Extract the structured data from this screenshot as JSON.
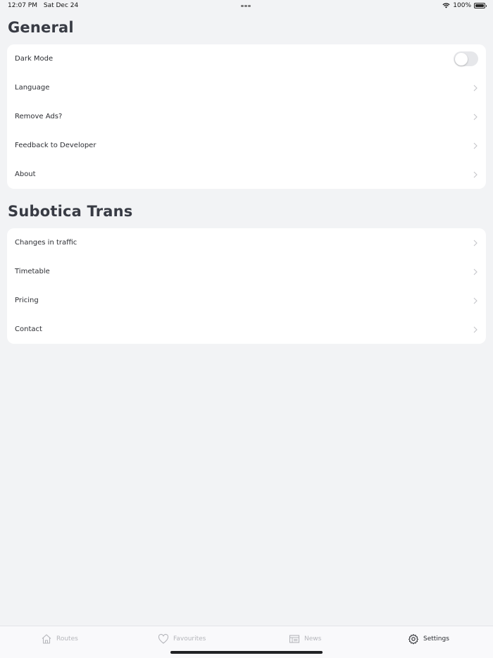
{
  "status_bar": {
    "time": "12:07 PM",
    "date": "Sat Dec 24",
    "battery": "100%",
    "icons": [
      "wifi-icon",
      "battery-icon"
    ]
  },
  "general": {
    "title": "General",
    "dark_mode": {
      "label": "Dark Mode",
      "enabled": false
    },
    "items": [
      {
        "label": "Language"
      },
      {
        "label": "Remove Ads?"
      },
      {
        "label": "Feedback to Developer"
      },
      {
        "label": "About"
      }
    ]
  },
  "subotica": {
    "title": "Subotica Trans",
    "items": [
      {
        "label": "Changes in traffic"
      },
      {
        "label": "Timetable"
      },
      {
        "label": "Pricing"
      },
      {
        "label": "Contact"
      }
    ]
  },
  "tabs": [
    {
      "label": "Routes",
      "icon": "home-icon",
      "active": false
    },
    {
      "label": "Favourites",
      "icon": "heart-icon",
      "active": false
    },
    {
      "label": "News",
      "icon": "newspaper-icon",
      "active": false
    },
    {
      "label": "Settings",
      "icon": "gear-icon",
      "active": true
    }
  ],
  "colors": {
    "background": "#f2f3f5",
    "card": "#ffffff",
    "active_tab": "#2a2c31",
    "inactive_tab": "#b5b6bb"
  }
}
